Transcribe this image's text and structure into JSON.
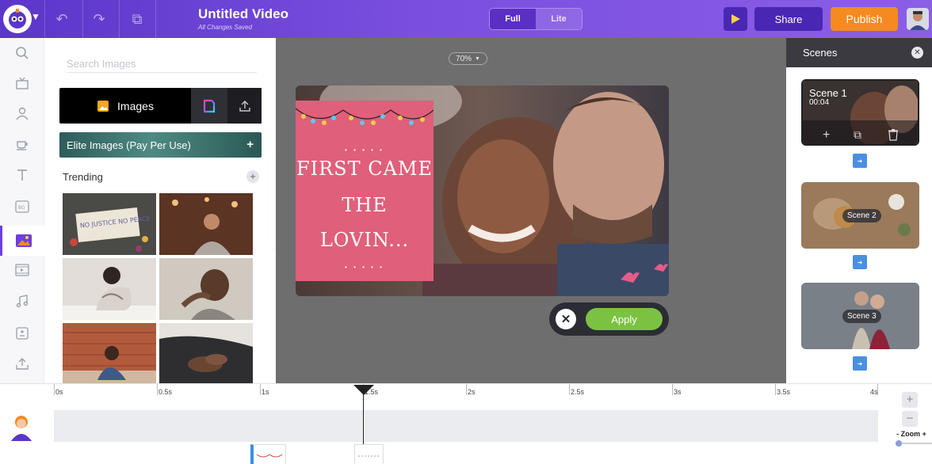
{
  "header": {
    "title": "Untitled Video",
    "save_status": "All Changes Saved",
    "mode_full": "Full",
    "mode_lite": "Lite",
    "share_label": "Share",
    "publish_label": "Publish",
    "colors": {
      "accent": "#6c3fe0",
      "publish": "#f58a1f"
    }
  },
  "library": {
    "search_placeholder": "Search Images",
    "images_tab_label": "Images",
    "elite_label": "Elite Images (Pay Per Use)",
    "trending_label": "Trending",
    "thumb1_text": "NO JUSTICE NO PEACE"
  },
  "canvas": {
    "zoom": "70%",
    "card_line1": "FIRST CAME",
    "card_line2": "THE",
    "card_line3": "LOVIN...",
    "apply_label": "Apply"
  },
  "scenes": {
    "title": "Scenes",
    "items": [
      {
        "name": "Scene 1",
        "duration": "00:04"
      },
      {
        "name": "Scene 2"
      },
      {
        "name": "Scene 3"
      }
    ]
  },
  "timeline": {
    "ticks": [
      "0s",
      "0.5s",
      "1s",
      "1.5s",
      "2s",
      "2.5s",
      "3s",
      "3.5s",
      "4s"
    ],
    "zoom_label": "Zoom",
    "zoom_minus": "-",
    "zoom_plus": "+"
  }
}
